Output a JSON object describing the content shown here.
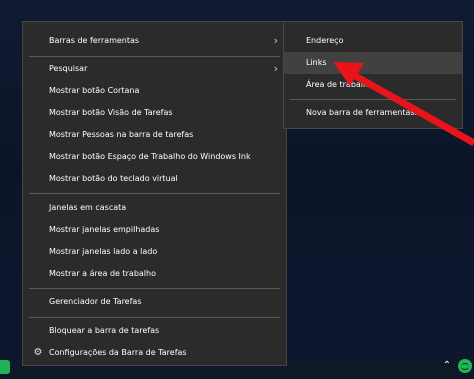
{
  "main_menu": {
    "items": [
      {
        "label": "Barras de ferramentas"
      },
      {
        "label": "Pesquisar"
      },
      {
        "label": "Mostrar botão Cortana"
      },
      {
        "label": "Mostrar botão Visão de Tarefas"
      },
      {
        "label": "Mostrar Pessoas na barra de tarefas"
      },
      {
        "label": "Mostrar botão Espaço de Trabalho do Windows Ink"
      },
      {
        "label": "Mostrar botão do teclado virtual"
      },
      {
        "label": "Janelas em cascata"
      },
      {
        "label": "Mostrar janelas empilhadas"
      },
      {
        "label": "Mostrar janelas lado a lado"
      },
      {
        "label": "Mostrar a área de trabalho"
      },
      {
        "label": "Gerenciador de Tarefas"
      },
      {
        "label": "Bloquear a barra de tarefas"
      },
      {
        "label": "Configurações da Barra de Tarefas"
      }
    ]
  },
  "sub_menu": {
    "items": [
      {
        "label": "Endereço"
      },
      {
        "label": "Links"
      },
      {
        "label": "Área de trabalho"
      },
      {
        "label": "Nova barra de ferramentas..."
      }
    ]
  },
  "icons": {
    "submenu": "chevron-right-icon",
    "settings": "gear-icon",
    "tray_overflow": "chevron-up-icon",
    "tray_app": "spotify-icon",
    "annotation": "red-arrow"
  },
  "colors": {
    "menu_bg": "#2b2b2b",
    "highlight": "#414141",
    "annotation_arrow": "#e8141a"
  }
}
